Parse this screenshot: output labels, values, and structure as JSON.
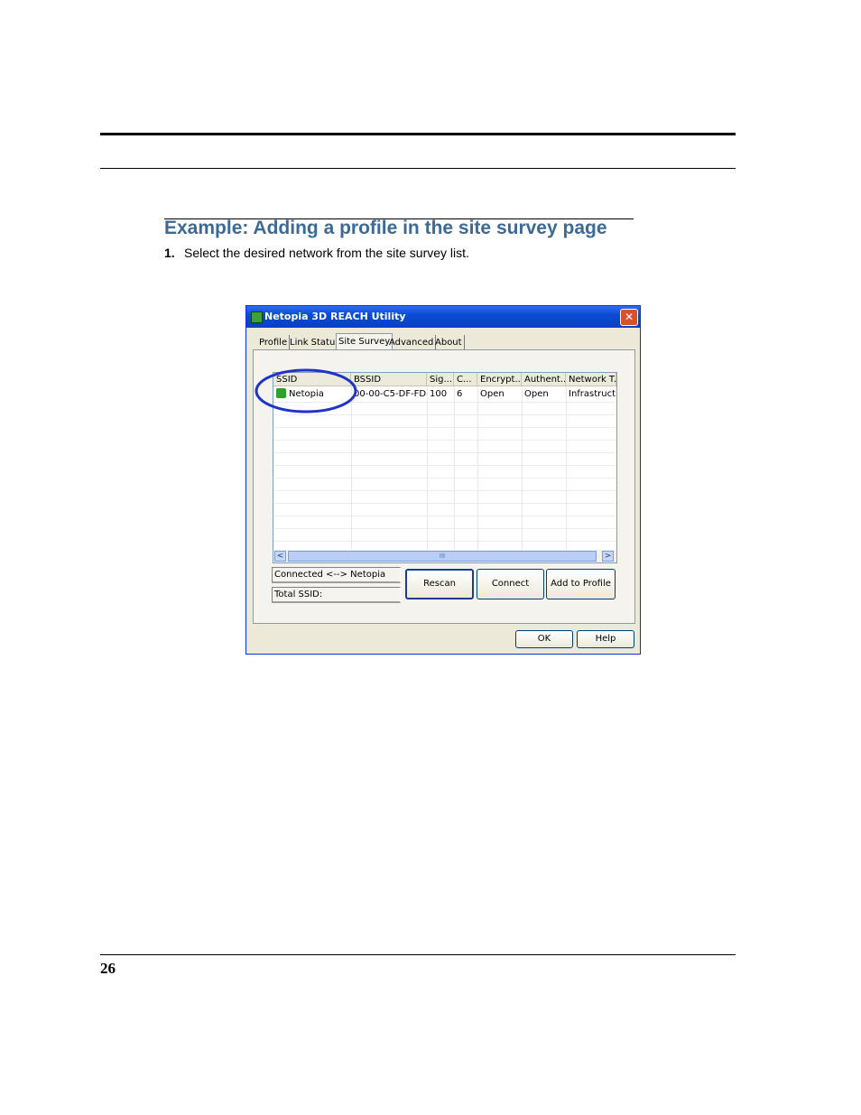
{
  "doc": {
    "heading": "Example: Adding a profile in the site survey page",
    "step_number": "1.",
    "step_text": "Select the desired network from the site survey list.",
    "page_number": "26"
  },
  "window": {
    "title": "Netopia 3D REACH Utility",
    "close_glyph": "✕",
    "tabs": [
      {
        "label": "Profile"
      },
      {
        "label": "Link Status"
      },
      {
        "label": "Site Survey",
        "active": true
      },
      {
        "label": "Advanced"
      },
      {
        "label": "About"
      }
    ],
    "list": {
      "columns": [
        "SSID",
        "BSSID",
        "Sig...",
        "C...",
        "Encrypt...",
        "Authent...",
        "Network T..."
      ],
      "rows": [
        {
          "ssid": "Netopia",
          "bssid": "00-00-C5-DF-FD...",
          "signal": "100",
          "channel": "6",
          "encryption": "Open",
          "authentication": "Open",
          "network_type": "Infrastruct..."
        }
      ],
      "scroll_mark": "III",
      "left_arrow": "<",
      "right_arrow": ">"
    },
    "status": {
      "connected": "Connected <--> Netopia",
      "total": "Total SSID:"
    },
    "buttons": {
      "rescan": "Rescan",
      "connect": "Connect",
      "add_to_profile": "Add to Profile",
      "ok": "OK",
      "help": "Help"
    },
    "colors": {
      "titlebar": "#0a4bd3",
      "highlight_circle": "#1f33c8",
      "heading": "#3d6a93"
    }
  }
}
